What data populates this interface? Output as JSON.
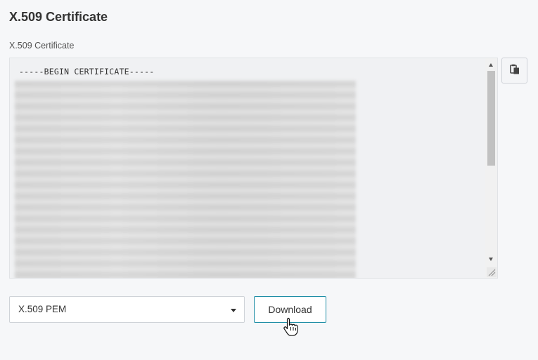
{
  "section": {
    "title": "X.509 Certificate"
  },
  "certificate_field": {
    "label": "X.509 Certificate",
    "begin_line": "-----BEGIN CERTIFICATE-----"
  },
  "copy_button": {
    "icon": "clipboard-icon"
  },
  "format_select": {
    "selected": "X.509 PEM"
  },
  "download_button": {
    "label": "Download",
    "accent_color": "#1f8ea6"
  }
}
